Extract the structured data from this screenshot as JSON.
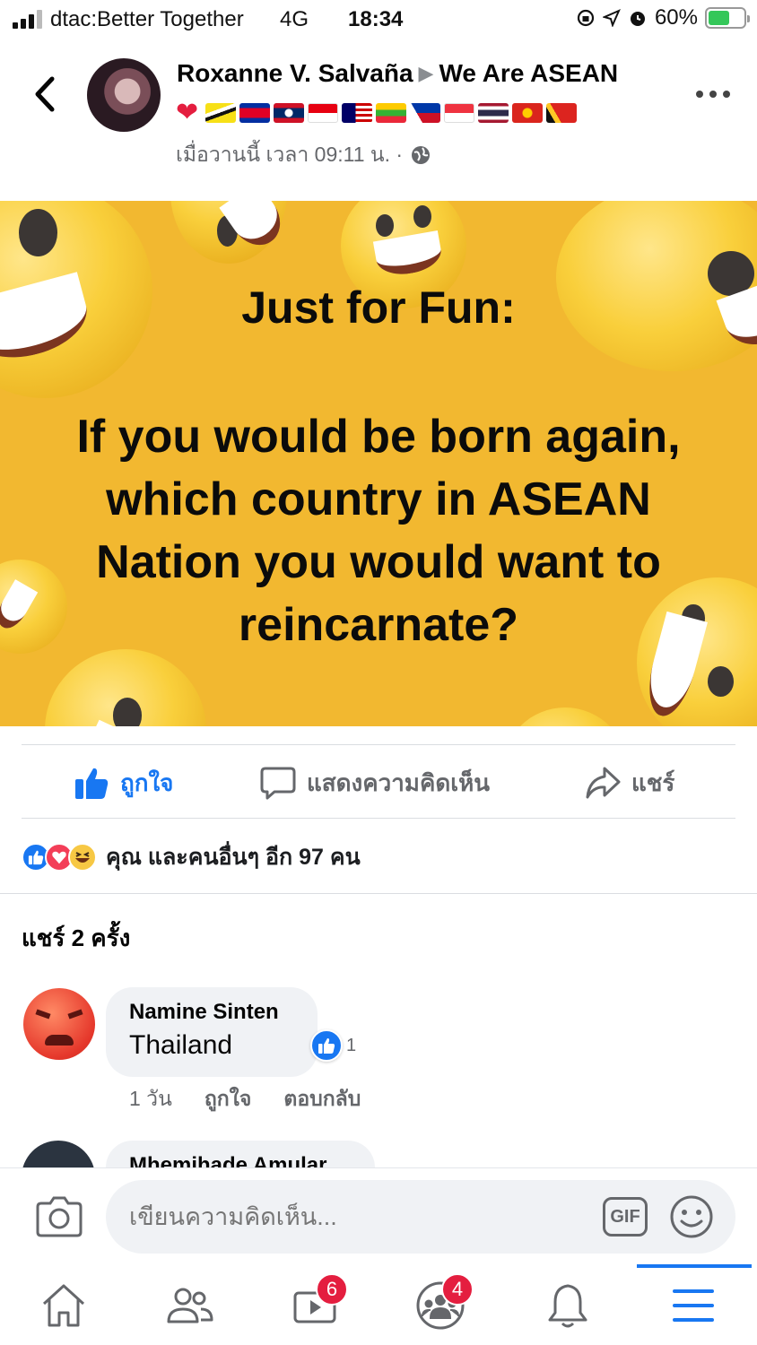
{
  "status_bar": {
    "carrier": "dtac:Better Together",
    "network": "4G",
    "time": "18:34",
    "battery": "60%",
    "battery_level": 0.6
  },
  "post": {
    "author": "Roxanne V. Salvaña",
    "group": "We Are ASEAN",
    "flags": [
      "brunei",
      "cambodia",
      "laos",
      "indonesia",
      "malaysia",
      "myanmar",
      "philippines",
      "singapore",
      "thailand",
      "vietnam",
      "timor-leste"
    ],
    "timestamp": "เมื่อวานนี้ เวลา 09:11 น. ·",
    "image_heading": "Just for Fun:",
    "image_text": "If you would be born again, which country in ASEAN Nation you would want to reincarnate?"
  },
  "actions": {
    "like": "ถูกใจ",
    "comment": "แสดงความคิดเห็น",
    "share": "แชร์"
  },
  "reactions": {
    "types": [
      "like",
      "love",
      "haha"
    ],
    "summary": "คุณ และคนอื่นๆ อีก 97 คน"
  },
  "shares": "แชร์ 2 ครั้ง",
  "comments": [
    {
      "author": "Namine Sinten",
      "text": "Thailand",
      "likes": "1",
      "time": "1 วัน",
      "like_label": "ถูกใจ",
      "reply_label": "ตอบกลับ"
    },
    {
      "author": "Mhemihade Amular"
    }
  ],
  "composer": {
    "placeholder": "เขียนความคิดเห็น...",
    "gif": "GIF"
  },
  "nav": {
    "watch_badge": "6",
    "groups_badge": "4"
  },
  "colors": {
    "accent": "#1877f2",
    "image_bg": "#f2b830",
    "badge": "#e41e3f"
  }
}
